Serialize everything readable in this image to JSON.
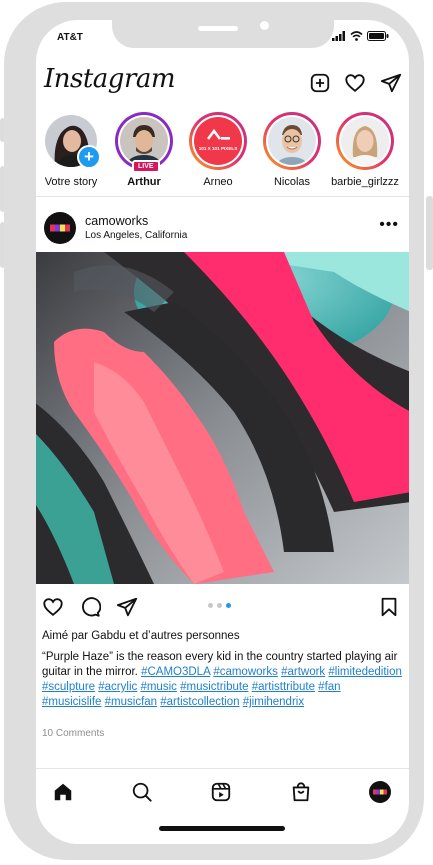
{
  "status": {
    "carrier": "AT&T"
  },
  "app": {
    "logo": "Instagram"
  },
  "header": {
    "icons": [
      "new-post-icon",
      "heart-icon",
      "direct-message-icon"
    ]
  },
  "stories": [
    {
      "label": "Votre story",
      "badge": "+"
    },
    {
      "label": "Arthur",
      "badge": "LIVE",
      "bold": true
    },
    {
      "label": "Arneo",
      "avatar_text": "101 X 101 PIXELS"
    },
    {
      "label": "Nicolas"
    },
    {
      "label": "barbie_girlzzz"
    }
  ],
  "post": {
    "username": "camoworks",
    "location": "Los Angeles, California",
    "more": "•••",
    "likes_prefix": "Aimé par",
    "likes_user": "Gabdu",
    "likes_suffix": "et d’autres personnes",
    "caption_text": "“Purple Haze” is the reason every kid in the country started playing air guitar in the mirror.",
    "hashtags": [
      "#CAMO3DLA",
      "#camoworks",
      "#artwork",
      "#limitededition",
      "#sculpture",
      "#acrylic",
      "#music",
      "#musictribute",
      "#artisttribute",
      "#fan",
      "#musicislife",
      "#musicfan",
      "#artistcollection",
      "#jimihendrix"
    ],
    "comments": "10 Comments",
    "carousel": {
      "count": 3,
      "active": 3
    }
  },
  "colors": {
    "accent": "#1d9bf0",
    "live": "#d4175e",
    "hashtag": "#1d7fd1"
  }
}
